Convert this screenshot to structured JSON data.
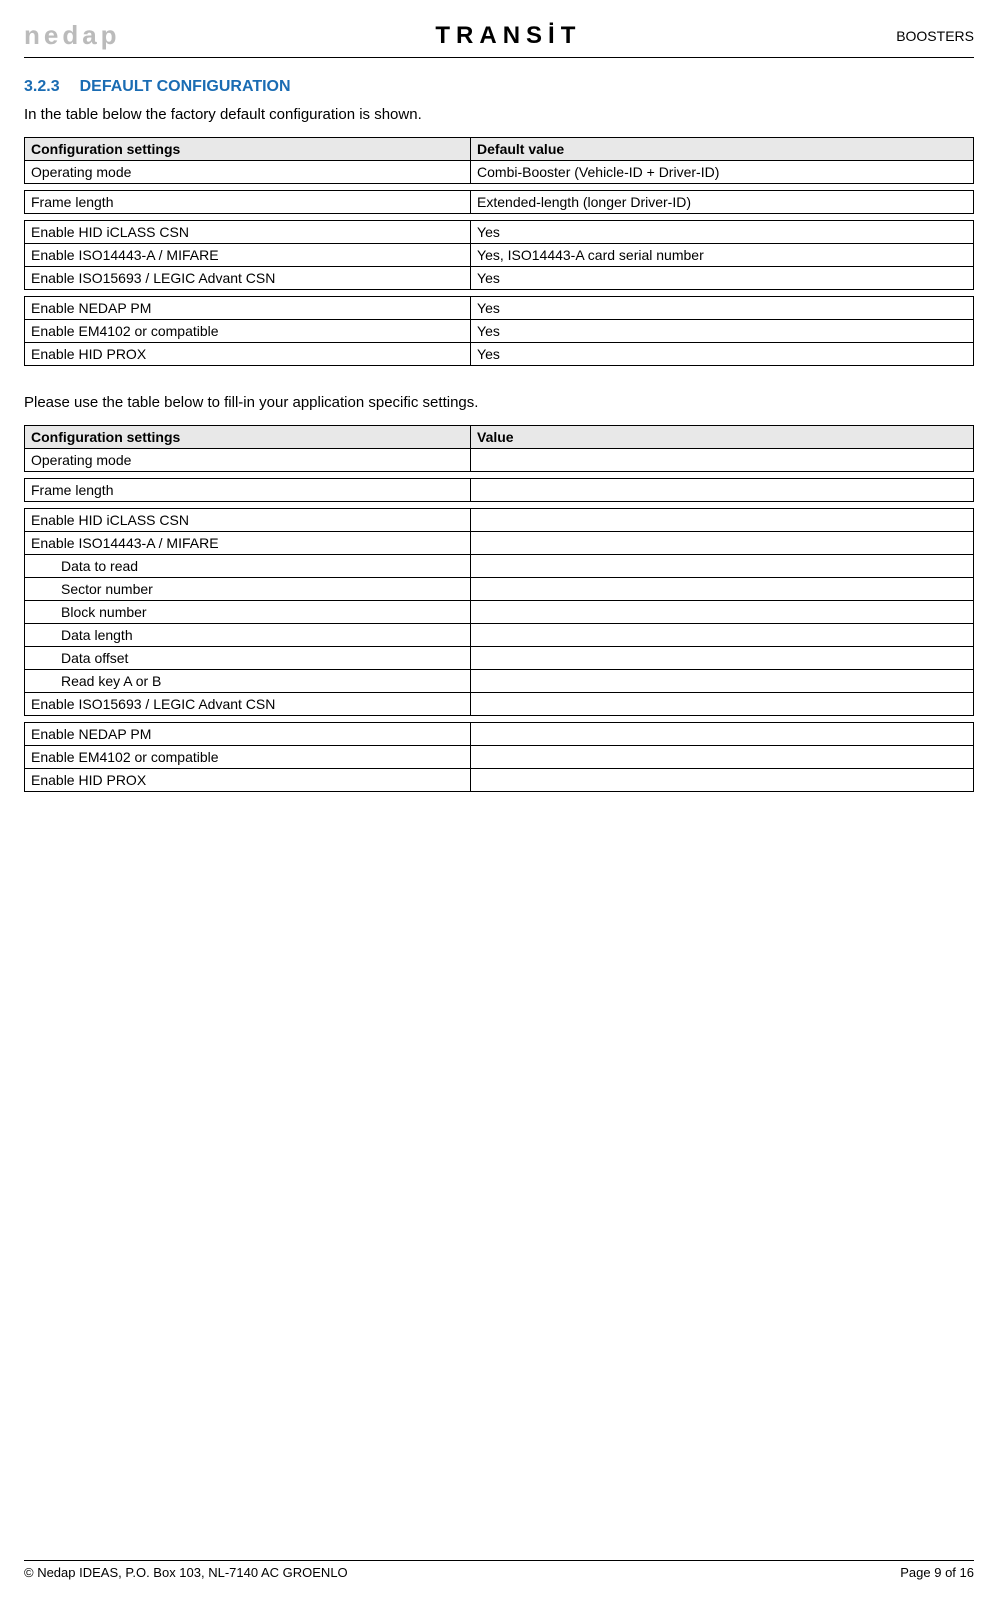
{
  "header": {
    "logo_left": "nedap",
    "logo_center": "TRANS",
    "logo_center_tail": "T",
    "right": "BOOSTERS"
  },
  "section": {
    "number": "3.2.3",
    "title": "DEFAULT CONFIGURATION",
    "intro": "In the table below the factory default configuration is shown."
  },
  "table1": {
    "h1": "Configuration settings",
    "h2": "Default value",
    "rows": [
      {
        "c1": "Operating mode",
        "c2": "Combi-Booster (Vehicle-ID + Driver-ID)"
      },
      {
        "c1": "Frame length",
        "c2": "Extended-length (longer Driver-ID)"
      },
      {
        "c1": "Enable HID iCLASS CSN",
        "c2": "Yes"
      },
      {
        "c1": "Enable ISO14443-A / MIFARE",
        "c2": "Yes, ISO14443-A card serial number"
      },
      {
        "c1": "Enable ISO15693 / LEGIC Advant CSN",
        "c2": "Yes"
      },
      {
        "c1": "Enable NEDAP PM",
        "c2": "Yes"
      },
      {
        "c1": "Enable EM4102 or compatible",
        "c2": "Yes"
      },
      {
        "c1": "Enable HID PROX",
        "c2": "Yes"
      }
    ]
  },
  "intro2": "Please use the table below to fill-in your application specific settings.",
  "table2": {
    "h1": "Configuration settings",
    "h2": "Value",
    "rows": [
      {
        "c1": "Operating mode",
        "c2": "",
        "indent": false
      },
      {
        "c1": "Frame length",
        "c2": "",
        "indent": false
      },
      {
        "c1": "Enable HID iCLASS CSN",
        "c2": "",
        "indent": false
      },
      {
        "c1": "Enable ISO14443-A / MIFARE",
        "c2": "",
        "indent": false
      },
      {
        "c1": "Data to read",
        "c2": "",
        "indent": true
      },
      {
        "c1": "Sector number",
        "c2": "",
        "indent": true
      },
      {
        "c1": "Block number",
        "c2": "",
        "indent": true
      },
      {
        "c1": "Data length",
        "c2": "",
        "indent": true
      },
      {
        "c1": "Data offset",
        "c2": "",
        "indent": true
      },
      {
        "c1": "Read key A or B",
        "c2": "",
        "indent": true
      },
      {
        "c1": "Enable ISO15693 / LEGIC Advant CSN",
        "c2": "",
        "indent": false
      },
      {
        "c1": "Enable NEDAP PM",
        "c2": "",
        "indent": false
      },
      {
        "c1": "Enable EM4102 or compatible",
        "c2": "",
        "indent": false
      },
      {
        "c1": "Enable HID PROX",
        "c2": "",
        "indent": false
      }
    ]
  },
  "footer": {
    "left": "© Nedap IDEAS, P.O. Box 103, NL-7140 AC GROENLO",
    "right": "Page 9 of 16"
  }
}
